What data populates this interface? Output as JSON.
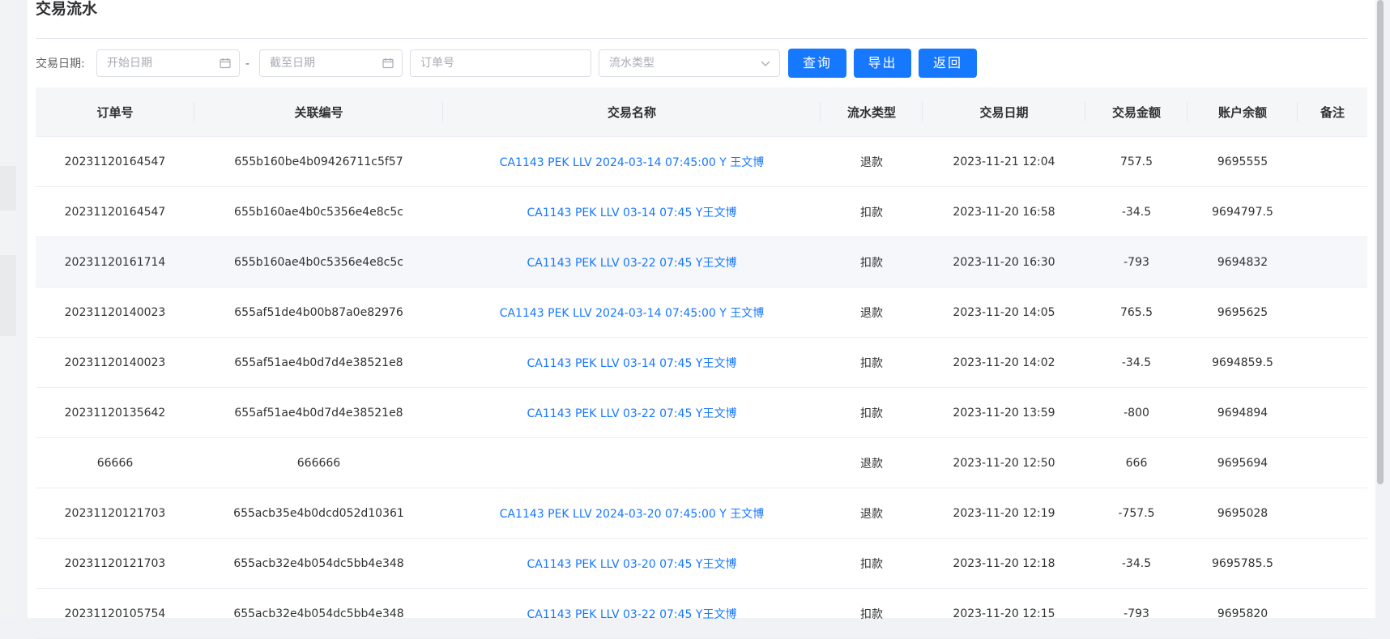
{
  "page": {
    "title": "交易流水"
  },
  "filters": {
    "date_label": "交易日期:",
    "start_placeholder": "开始日期",
    "end_placeholder": "截至日期",
    "separator": "-",
    "order_placeholder": "订单号",
    "type_placeholder": "流水类型"
  },
  "buttons": {
    "query": "查询",
    "export": "导出",
    "back": "返回"
  },
  "table": {
    "headers": [
      "订单号",
      "关联编号",
      "交易名称",
      "流水类型",
      "交易日期",
      "交易金额",
      "账户余额",
      "备注"
    ],
    "rows": [
      {
        "order": "20231120164547",
        "ref": "655b160be4b09426711c5f57",
        "name": "CA1143 PEK LLV 2024-03-14 07:45:00 Y 王文博",
        "type": "退款",
        "date": "2023-11-21 12:04",
        "amount": "757.5",
        "balance": "9695555",
        "remark": ""
      },
      {
        "order": "20231120164547",
        "ref": "655b160ae4b0c5356e4e8c5c",
        "name": "CA1143 PEK LLV 03-14 07:45 Y王文博",
        "type": "扣款",
        "date": "2023-11-20 16:58",
        "amount": "-34.5",
        "balance": "9694797.5",
        "remark": ""
      },
      {
        "order": "20231120161714",
        "ref": "655b160ae4b0c5356e4e8c5c",
        "name": "CA1143 PEK LLV 03-22 07:45 Y王文博",
        "type": "扣款",
        "date": "2023-11-20 16:30",
        "amount": "-793",
        "balance": "9694832",
        "remark": ""
      },
      {
        "order": "20231120140023",
        "ref": "655af51de4b00b87a0e82976",
        "name": "CA1143 PEK LLV 2024-03-14 07:45:00 Y 王文博",
        "type": "退款",
        "date": "2023-11-20 14:05",
        "amount": "765.5",
        "balance": "9695625",
        "remark": ""
      },
      {
        "order": "20231120140023",
        "ref": "655af51ae4b0d7d4e38521e8",
        "name": "CA1143 PEK LLV 03-14 07:45 Y王文博",
        "type": "扣款",
        "date": "2023-11-20 14:02",
        "amount": "-34.5",
        "balance": "9694859.5",
        "remark": ""
      },
      {
        "order": "20231120135642",
        "ref": "655af51ae4b0d7d4e38521e8",
        "name": "CA1143 PEK LLV 03-22 07:45 Y王文博",
        "type": "扣款",
        "date": "2023-11-20 13:59",
        "amount": "-800",
        "balance": "9694894",
        "remark": ""
      },
      {
        "order": "66666",
        "ref": "666666",
        "name": "",
        "type": "退款",
        "date": "2023-11-20 12:50",
        "amount": "666",
        "balance": "9695694",
        "remark": ""
      },
      {
        "order": "20231120121703",
        "ref": "655acb35e4b0dcd052d10361",
        "name": "CA1143 PEK LLV 2024-03-20 07:45:00 Y 王文博",
        "type": "退款",
        "date": "2023-11-20 12:19",
        "amount": "-757.5",
        "balance": "9695028",
        "remark": ""
      },
      {
        "order": "20231120121703",
        "ref": "655acb32e4b054dc5bb4e348",
        "name": "CA1143 PEK LLV 03-20 07:45 Y王文博",
        "type": "扣款",
        "date": "2023-11-20 12:18",
        "amount": "-34.5",
        "balance": "9695785.5",
        "remark": ""
      },
      {
        "order": "20231120105754",
        "ref": "655acb32e4b054dc5bb4e348",
        "name": "CA1143 PEK LLV 03-22 07:45 Y王文博",
        "type": "扣款",
        "date": "2023-11-20 12:15",
        "amount": "-793",
        "balance": "9695820",
        "remark": ""
      }
    ]
  },
  "icons": {
    "calendar": "calendar-icon",
    "dropdown": "chevron-down-icon"
  },
  "colors": {
    "primary": "#1677ff",
    "link": "#1677ff",
    "header_bg": "#f5f6f8"
  }
}
